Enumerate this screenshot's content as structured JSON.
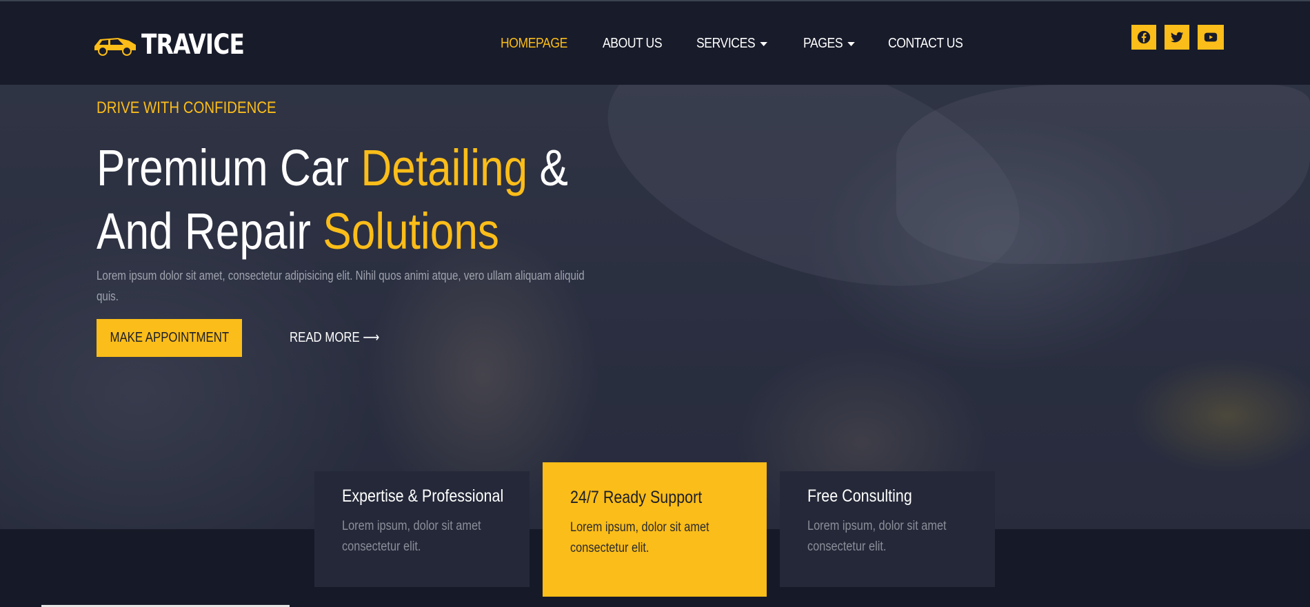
{
  "brand": {
    "name": "TRAVICE",
    "accent_color": "#fbbd19",
    "dark_color": "#181b2a",
    "logo_icon": "car-icon"
  },
  "nav": {
    "items": [
      {
        "label": "HOMEPAGE",
        "active": true,
        "dropdown": false
      },
      {
        "label": "ABOUT US",
        "active": false,
        "dropdown": false
      },
      {
        "label": "SERVICES",
        "active": false,
        "dropdown": true
      },
      {
        "label": "PAGES",
        "active": false,
        "dropdown": true
      },
      {
        "label": "CONTACT US",
        "active": false,
        "dropdown": false
      }
    ]
  },
  "socials": [
    {
      "icon": "facebook-icon"
    },
    {
      "icon": "twitter-icon"
    },
    {
      "icon": "youtube-icon"
    }
  ],
  "hero": {
    "eyebrow": "DRIVE WITH CONFIDENCE",
    "headline_part1": "Premium Car ",
    "headline_hl1": "Detailing",
    "headline_part2": " &",
    "headline_part3": "And Repair ",
    "headline_hl2": "Solutions",
    "description": "Lorem ipsum dolor sit amet, consectetur adipisicing elit. Nihil quos animi atque, vero ullam aliquam aliquid quis.",
    "primary_button": "MAKE APPOINTMENT",
    "secondary_link": "READ MORE ⟶"
  },
  "features": [
    {
      "title": "Expertise & Professional",
      "description": "Lorem ipsum, dolor sit amet consectetur elit.",
      "highlighted": false
    },
    {
      "title": "24/7 Ready Support",
      "description": "Lorem ipsum, dolor sit amet consectetur elit.",
      "highlighted": true
    },
    {
      "title": "Free Consulting",
      "description": "Lorem ipsum, dolor sit amet consectetur elit.",
      "highlighted": false
    }
  ]
}
